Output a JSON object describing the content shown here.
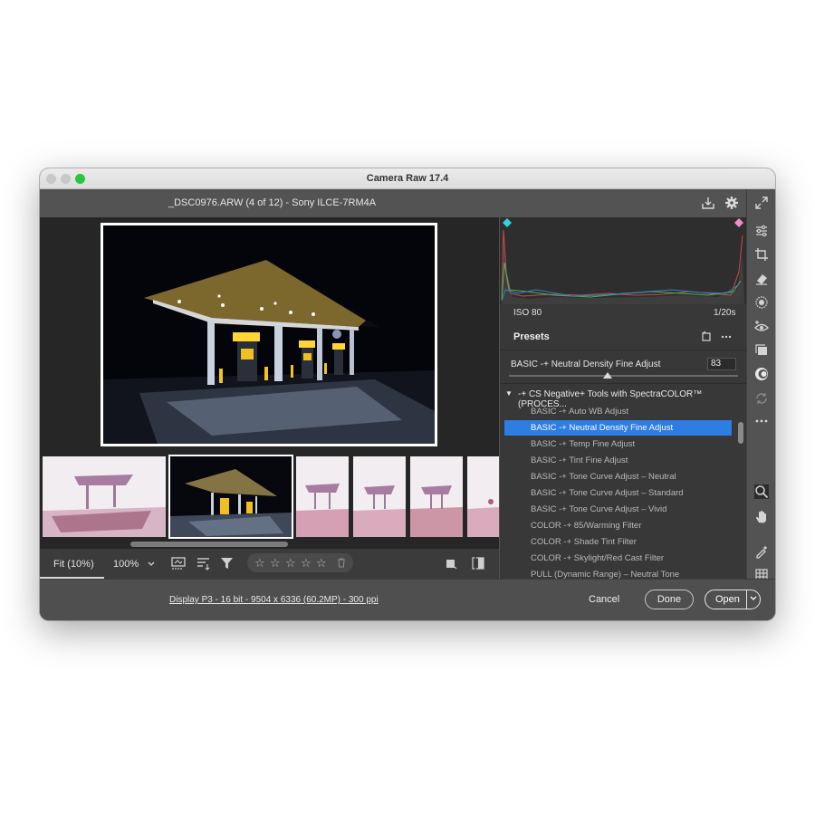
{
  "window": {
    "title": "Camera Raw 17.4"
  },
  "header": {
    "file_info": "_DSC0976.ARW (4 of 12)  -  Sony ILCE-7RM4A"
  },
  "histogram": {
    "iso": "ISO 80",
    "shutter": "1/20s"
  },
  "presets": {
    "title": "Presets",
    "amount_label": "BASIC -+ Neutral Density Fine Adjust",
    "amount_value": "83",
    "amount_fraction": 0.43,
    "group": "-+ CS Negative+ Tools with SpectraCOLOR™ (PROCES...",
    "items": [
      "BASIC -+ Auto WB Adjust",
      "BASIC -+ Neutral Density Fine Adjust",
      "BASIC -+ Temp Fine Adjust",
      "BASIC -+ Tint Fine Adjust",
      "BASIC -+ Tone Curve Adjust – Neutral",
      "BASIC -+ Tone Curve Adjust – Standard",
      "BASIC -+ Tone Curve Adjust – Vivid",
      "COLOR -+ 85/Warming Filter",
      "COLOR -+ Shade Tint Filter",
      "COLOR -+ Skylight/Red Cast Filter",
      "PULL (Dynamic Range) – Neutral Tone"
    ],
    "selected_index": 1
  },
  "toolbar": {
    "fit_label": "Fit (10%)",
    "zoom_label": "100%"
  },
  "footer": {
    "display_info": "Display P3 - 16 bit - 9504 x 6336 (60.2MP) - 300 ppi",
    "cancel_label": "Cancel",
    "done_label": "Done",
    "open_label": "Open"
  },
  "colors": {
    "accent": "#2d7de2",
    "close_green": "#2ac540"
  }
}
